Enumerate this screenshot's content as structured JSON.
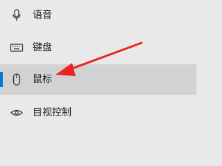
{
  "nav": {
    "items": [
      {
        "label": "语音",
        "icon": "microphone-icon",
        "selected": false
      },
      {
        "label": "键盘",
        "icon": "keyboard-icon",
        "selected": false
      },
      {
        "label": "鼠标",
        "icon": "mouse-icon",
        "selected": true
      },
      {
        "label": "目视控制",
        "icon": "eye-control-icon",
        "selected": false
      }
    ]
  },
  "colors": {
    "accent": "#0078d7",
    "selected_bg": "#d2d2d2",
    "panel_bg": "#e9e9e9",
    "annotation_arrow": "#ee2222"
  }
}
